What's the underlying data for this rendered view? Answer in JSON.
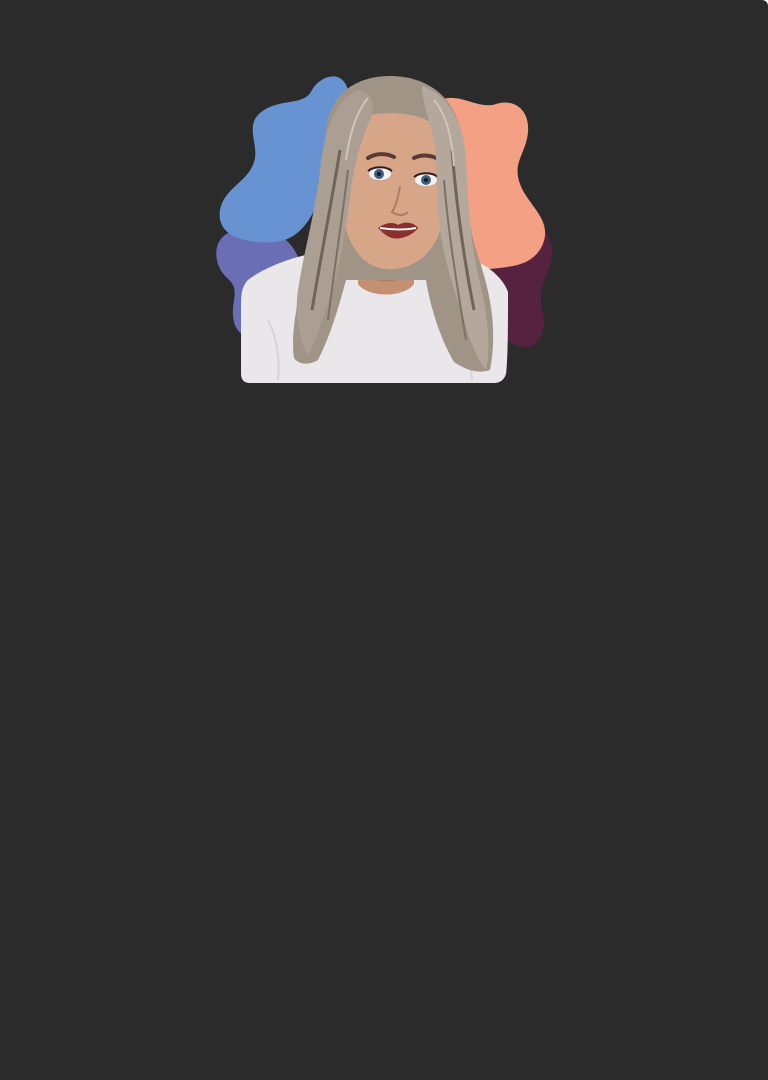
{
  "app": {
    "background_color": "#2b2b2b"
  },
  "avatar": {
    "icon": "illustrated-portrait-avatar",
    "colors": {
      "blob_blue": "#6793d3",
      "blob_purple": "#6a6fb5",
      "blob_peach": "#f4a085",
      "blob_plum": "#55233f",
      "shirt": "#e9e7ea",
      "hair": "#a89d90",
      "skin": "#d7a588"
    }
  }
}
